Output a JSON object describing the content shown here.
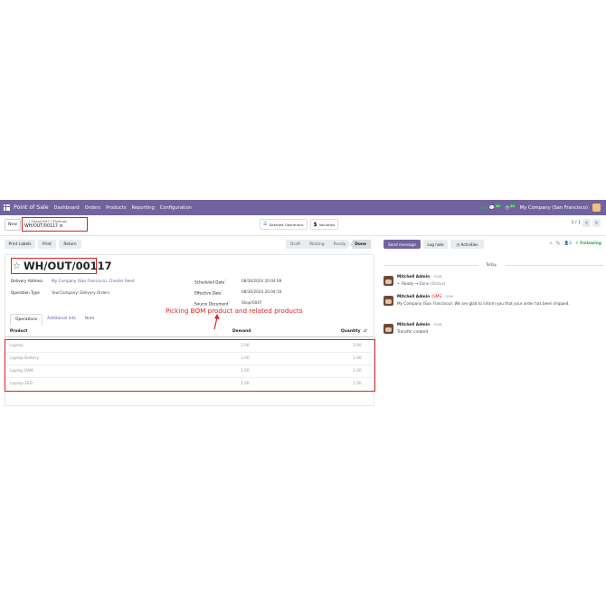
{
  "navbar": {
    "brand": "Point of Sale",
    "menus": [
      "Dashboard",
      "Orders",
      "Products",
      "Reporting",
      "Configuration"
    ],
    "messages_count": "10",
    "activities_count": "24",
    "company": "My Company (San Francisco)"
  },
  "control_panel": {
    "new_label": "New",
    "breadcrumb_ellipsis": "...",
    "breadcrumb_1": "Shop/0047",
    "breadcrumb_2": "Pickings",
    "record_name": "WH/OUT/00117",
    "detailed_operations": "Detailed Operations",
    "valuation": "Valuation",
    "pager": "1 / 1"
  },
  "statusbar": {
    "buttons": [
      "Print Labels",
      "Print",
      "Return"
    ],
    "stages": [
      "Draft",
      "Waiting",
      "Ready",
      "Done"
    ],
    "current_stage": "Done"
  },
  "form": {
    "title": "WH/OUT/00117",
    "delivery_address_label": "Delivery Address",
    "delivery_address": "My Company (San Francisco), Chester Reed",
    "operation_type_label": "Operation Type",
    "operation_type": "YourCompany: Delivery Orders",
    "scheduled_date_label": "Scheduled Date",
    "scheduled_date": "08/30/2024 20:04:09",
    "effective_date_label": "Effective Date",
    "effective_date": "08/30/2024 20:04:16",
    "source_document_label": "Source Document",
    "source_document": "Shop/0047",
    "tabs": [
      "Operations",
      "Additional Info",
      "Note"
    ],
    "annotation": "Picking BOM product and related products",
    "columns": {
      "product": "Product",
      "demand": "Demand",
      "quantity": "Quantity"
    },
    "lines": [
      {
        "product": "Laptop",
        "demand": "1.00",
        "quantity": "1.00"
      },
      {
        "product": "Laptop Battery",
        "demand": "1.00",
        "quantity": "1.00"
      },
      {
        "product": "Laptop RAM",
        "demand": "1.00",
        "quantity": "1.00"
      },
      {
        "product": "Laptop SSD",
        "demand": "1.00",
        "quantity": "1.00"
      }
    ]
  },
  "chatter": {
    "send_message": "Send message",
    "log_note": "Log note",
    "activities": "Activities",
    "followers_count": "2",
    "following": "Following",
    "today": "Today",
    "messages": [
      {
        "author": "Mitchell Admin",
        "time": "now",
        "from": "Ready",
        "to": "Done",
        "field": "(Status)"
      },
      {
        "author": "Mitchell Admin",
        "sms": "SMS",
        "time": "now",
        "body": "My Company (San Francisco): We are glad to inform you that your order has been shipped."
      },
      {
        "author": "Mitchell Admin",
        "time": "now",
        "body": "Transfer created"
      }
    ]
  }
}
